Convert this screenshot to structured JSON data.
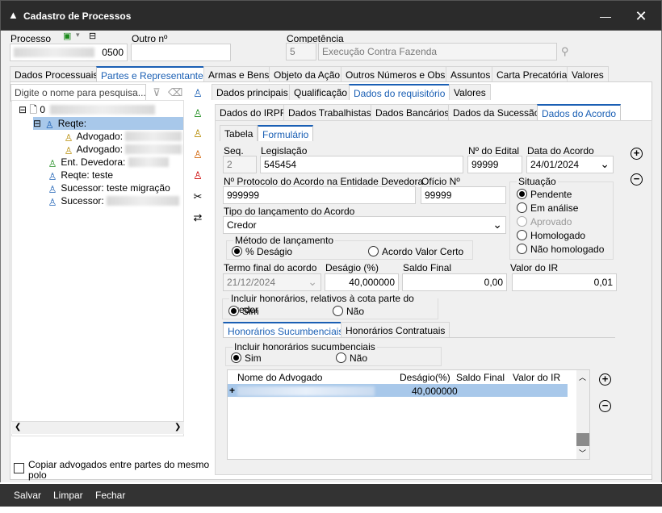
{
  "window": {
    "title": "Cadastro de Processos",
    "minimize": "—",
    "close": "✕"
  },
  "header": {
    "processo_label": "Processo",
    "processo_value": "0500",
    "outro_label": "Outro nº",
    "outro_value": "",
    "competencia_label": "Competência",
    "competencia_code": "5",
    "competencia_desc": "Execução Contra Fazenda"
  },
  "main_tabs": [
    "Dados Processuais",
    "Partes e Representantes",
    "Armas e Bens",
    "Objeto da Ação",
    "Outros Números e Obs.",
    "Assuntos",
    "Carta Precatória",
    "Valores"
  ],
  "left_panel": {
    "search_placeholder": "Digite o nome para pesquisa...",
    "tree": [
      {
        "label": "0",
        "redacted": true
      },
      {
        "label": "Reqte: ",
        "redacted": true
      },
      {
        "label": "Advogado: ",
        "redacted": true
      },
      {
        "label": "Advogado: ",
        "redacted": true
      },
      {
        "label": "Ent. Devedora: ",
        "redacted": true
      },
      {
        "label": "Reqte: teste",
        "redacted": false
      },
      {
        "label": "Sucessor: teste  migração",
        "redacted": false
      },
      {
        "label": "Sucessor: ",
        "redacted": true
      }
    ],
    "copy_label": "Copiar advogados entre partes do mesmo polo"
  },
  "sub_tabs": [
    "Dados principais",
    "Qualificação",
    "Dados do requisitório",
    "Valores"
  ],
  "req_tabs": [
    "Dados do IRPF",
    "Dados Trabalhistas",
    "Dados Bancários",
    "Dados da Sucessão",
    "Dados do Acordo"
  ],
  "view_tabs": [
    "Tabela",
    "Formulário"
  ],
  "form": {
    "seq_label": "Seq.",
    "seq_value": "2",
    "legislacao_label": "Legislação",
    "legislacao_value": "545454",
    "edital_label": "Nº do Edital",
    "edital_value": "99999",
    "data_acordo_label": "Data do Acordo",
    "data_acordo_value": "24/01/2024",
    "protocolo_label": "Nº Protocolo do Acordo na Entidade Devedora",
    "protocolo_value": "999999",
    "oficio_label": "Ofício Nº",
    "oficio_value": "99999",
    "situacao_label": "Situação",
    "situacao_options": [
      "Pendente",
      "Em análise",
      "Aprovado",
      "Homologado",
      "Não homologado"
    ],
    "tipo_label": "Tipo do lançamento do Acordo",
    "tipo_value": "Credor",
    "metodo_label": "Método de lançamento",
    "metodo_opt1": "% Deságio",
    "metodo_opt2": "Acordo Valor Certo",
    "termo_label": "Termo final do acordo",
    "termo_value": "21/12/2024",
    "desagio_label": "Deságio (%)",
    "desagio_value": "40,000000",
    "saldo_label": "Saldo Final",
    "saldo_value": "0,00",
    "valor_ir_label": "Valor do IR",
    "valor_ir_value": "0,01",
    "honor_label": "Incluir honorários, relativos à cota parte do credor",
    "sim": "Sim",
    "nao": "Não"
  },
  "honor_tabs": [
    "Honorários Sucumbenciais",
    "Honorários Contratuais"
  ],
  "sucumb": {
    "label": "Incluir honorários sucumbenciais",
    "columns": [
      "Nome do Advogado",
      "Deságio(%)",
      "Saldo Final",
      "Valor do IR"
    ],
    "row": {
      "expander": "+",
      "desagio": "40,000000"
    }
  },
  "footer": {
    "salvar": "Salvar",
    "limpar": "Limpar",
    "fechar": "Fechar"
  },
  "colors": {
    "accent": "#1a5fb4",
    "selected_row": "#a8c8ea",
    "titlebar": "#2b2b2b"
  }
}
